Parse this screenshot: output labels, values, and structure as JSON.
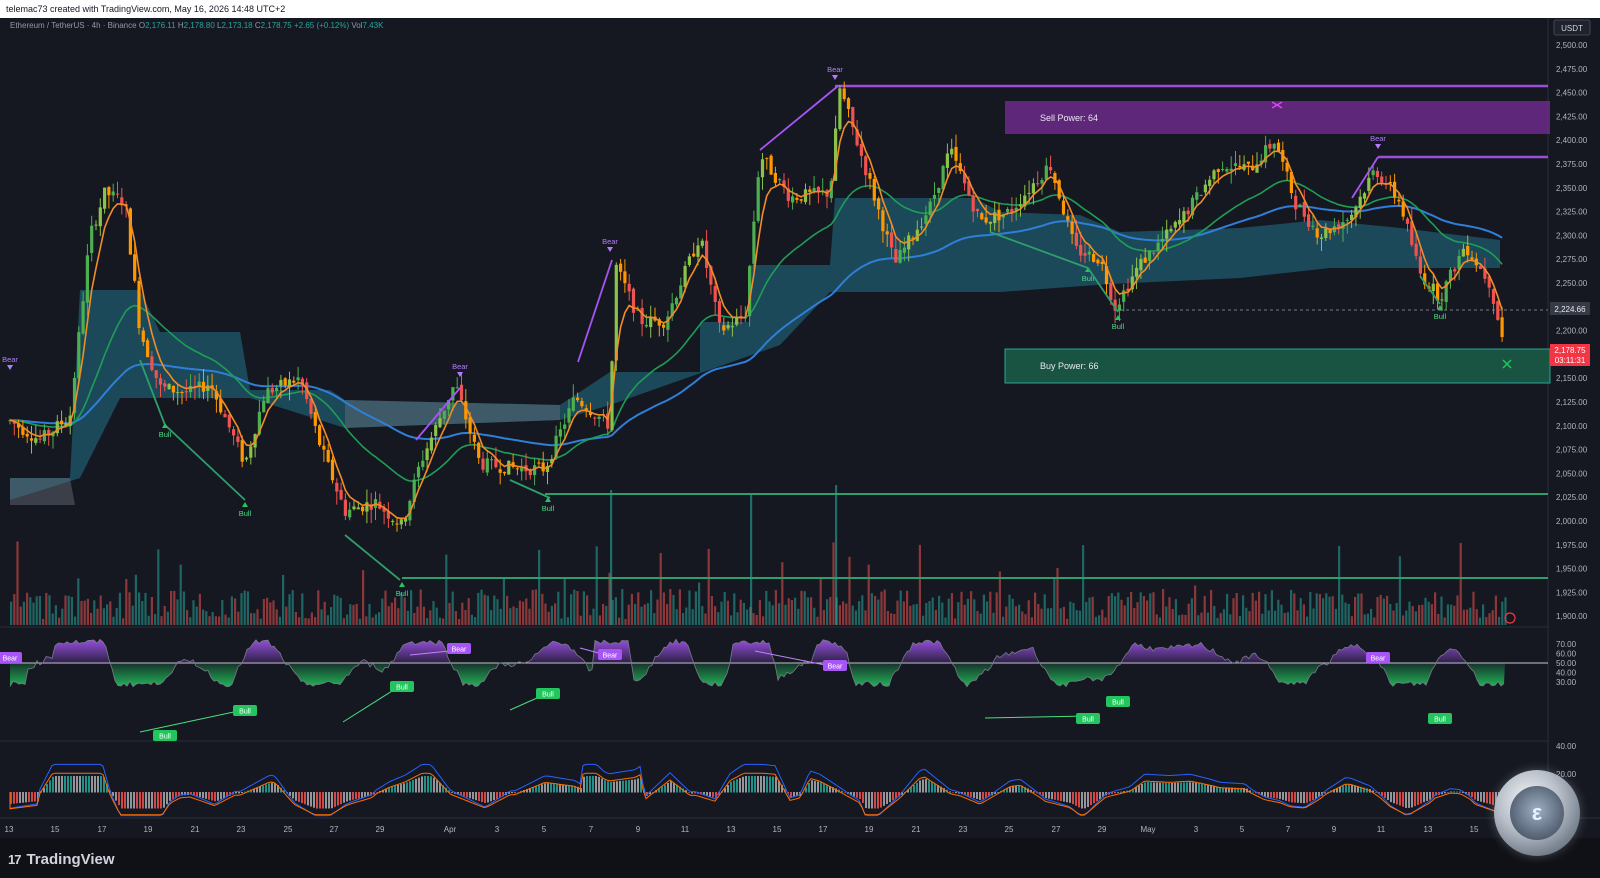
{
  "attribution": "telemac73 created with TradingView.com, May 16, 2026 14:48 UTC+2",
  "symbol_line": "Ethereum / TetherUS · 4h · Binance",
  "ohlc": {
    "o_label": "O",
    "o": "2,176.11",
    "h_label": "H",
    "h": "2,178.80",
    "l_label": "L",
    "l": "2,173.18",
    "c_label": "C",
    "c": "2,178.75",
    "change": "+2.65 (+0.12%)",
    "vol_label": "Vol",
    "vol": "7.43K"
  },
  "currency_badge": "USDT",
  "price_axis": [
    "2,500.00",
    "2,475.00",
    "2,450.00",
    "2,425.00",
    "2,400.00",
    "2,375.00",
    "2,350.00",
    "2,325.00",
    "2,300.00",
    "2,275.00",
    "2,250.00",
    "2,225.00",
    "2,200.00",
    "2,175.00",
    "2,150.00",
    "2,125.00",
    "2,100.00",
    "2,075.00",
    "2,050.00",
    "2,025.00",
    "2,000.00",
    "1,975.00",
    "1,950.00",
    "1,925.00",
    "1,900.00"
  ],
  "price_tags": {
    "level": "2,224.66",
    "last": "2,178.75",
    "countdown": "03:11:31"
  },
  "zones": {
    "sell": "Sell Power: 64",
    "buy": "Buy Power: 66"
  },
  "signal_labels": {
    "bear": "Bear",
    "bull": "Bull"
  },
  "rsi_axis": [
    "70.00",
    "60.00",
    "50.00",
    "40.00",
    "30.00"
  ],
  "macd_axis": [
    "40.00",
    "20.00"
  ],
  "time_axis": [
    "13",
    "15",
    "17",
    "19",
    "21",
    "23",
    "25",
    "27",
    "29",
    "Apr",
    "3",
    "5",
    "7",
    "9",
    "11",
    "13",
    "15",
    "17",
    "19",
    "21",
    "23",
    "25",
    "27",
    "29",
    "May",
    "3",
    "5",
    "7",
    "9",
    "11",
    "13",
    "15"
  ],
  "colors": {
    "bg": "#151821",
    "up": "#26a69a",
    "down": "#ef5350",
    "bull_green": "#22c55e",
    "bear_purple": "#a855f7",
    "cloud": "#1e5a6e",
    "ema_blue": "#2f7fd8",
    "ema_green": "#1f9d55",
    "ema_orange": "#f28c28"
  },
  "brand": "TradingView",
  "icons": {
    "brand_mark": "tradingview-logo-icon",
    "coin": "coin-watermark-icon"
  }
}
